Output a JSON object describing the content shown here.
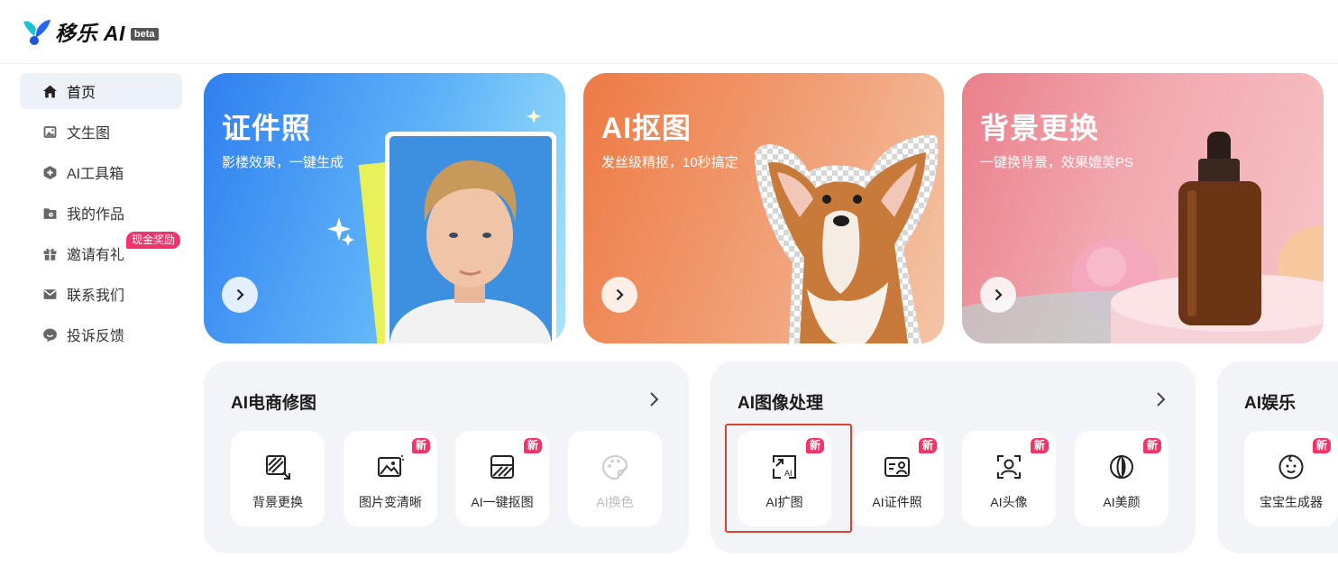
{
  "app": {
    "name": "移乐 AI",
    "beta": "beta"
  },
  "sidebar": {
    "items": [
      {
        "label": "首页",
        "icon": "home-icon",
        "active": true
      },
      {
        "label": "文生图",
        "icon": "image-icon"
      },
      {
        "label": "AI工具箱",
        "icon": "toolbox-icon"
      },
      {
        "label": "我的作品",
        "icon": "folder-icon"
      },
      {
        "label": "邀请有礼",
        "icon": "gift-icon",
        "badge": "现金奖励"
      },
      {
        "label": "联系我们",
        "icon": "mail-icon"
      },
      {
        "label": "投诉反馈",
        "icon": "feedback-icon"
      }
    ]
  },
  "banners": [
    {
      "title": "证件照",
      "subtitle": "影楼效果，一键生成"
    },
    {
      "title": "AI抠图",
      "subtitle": "发丝级精抠，10秒搞定"
    },
    {
      "title": "背景更换",
      "subtitle": "一键换背景，效果媲美PS"
    }
  ],
  "sections": [
    {
      "title": "AI电商修图",
      "tools": [
        {
          "label": "背景更换",
          "icon": "background-swap-icon"
        },
        {
          "label": "图片变清晰",
          "icon": "image-enhance-icon",
          "badge": "新"
        },
        {
          "label": "AI一键抠图",
          "icon": "cutout-icon",
          "badge": "新"
        },
        {
          "label": "AI换色",
          "icon": "palette-icon",
          "disabled": true
        }
      ]
    },
    {
      "title": "AI图像处理",
      "tools": [
        {
          "label": "AI扩图",
          "icon": "expand-image-icon",
          "badge": "新",
          "highlighted": true
        },
        {
          "label": "AI证件照",
          "icon": "id-card-icon",
          "badge": "新"
        },
        {
          "label": "AI头像",
          "icon": "avatar-scan-icon",
          "badge": "新"
        },
        {
          "label": "AI美颜",
          "icon": "beauty-icon",
          "badge": "新"
        }
      ]
    },
    {
      "title": "AI娱乐",
      "tools": [
        {
          "label": "宝宝生成器",
          "icon": "baby-face-icon",
          "badge": "新"
        }
      ]
    }
  ],
  "colors": {
    "badge": "#f2346b",
    "highlight": "#d9442e",
    "active_nav": "#edf1f8",
    "card_bg": "#f3f4f7"
  }
}
